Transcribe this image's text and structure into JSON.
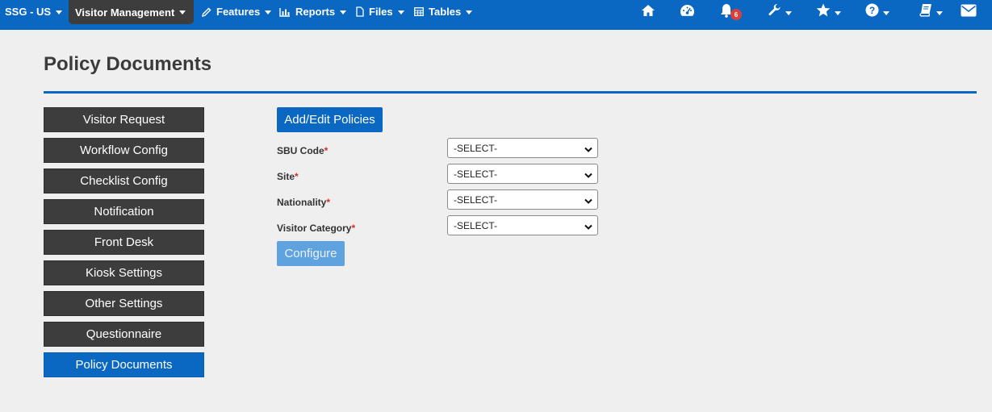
{
  "navbar": {
    "org_label": "SSG - US",
    "active_module": "Visitor Management",
    "menus": [
      {
        "label": "Features",
        "icon": "pencil-icon"
      },
      {
        "label": "Reports",
        "icon": "bar-chart-icon"
      },
      {
        "label": "Files",
        "icon": "file-icon"
      },
      {
        "label": "Tables",
        "icon": "table-icon"
      }
    ],
    "notification_count": "6",
    "right_icons": [
      "home-icon",
      "dashboard-icon",
      "bell-icon",
      "wrench-icon",
      "star-icon",
      "help-icon",
      "book-icon",
      "envelope-icon"
    ],
    "colors": {
      "bar": "#0a67c2",
      "active": "#3d3d3d",
      "badge": "#d9403a"
    }
  },
  "page": {
    "title": "Policy Documents"
  },
  "sidebar": {
    "items": [
      {
        "label": "Visitor Request",
        "active": false
      },
      {
        "label": "Workflow Config",
        "active": false
      },
      {
        "label": "Checklist Config",
        "active": false
      },
      {
        "label": "Notification",
        "active": false
      },
      {
        "label": "Front Desk",
        "active": false
      },
      {
        "label": "Kiosk Settings",
        "active": false
      },
      {
        "label": "Other Settings",
        "active": false
      },
      {
        "label": "Questionnaire",
        "active": false
      },
      {
        "label": "Policy Documents",
        "active": true
      }
    ]
  },
  "form": {
    "add_edit_label": "Add/Edit Policies",
    "required_mark": "*",
    "fields": [
      {
        "label": "SBU Code",
        "value": "-SELECT-"
      },
      {
        "label": "Site",
        "value": "-SELECT-"
      },
      {
        "label": "Nationality",
        "value": "-SELECT-"
      },
      {
        "label": "Visitor Category",
        "value": "-SELECT-"
      }
    ],
    "configure_label": "Configure",
    "configure_disabled": true
  }
}
